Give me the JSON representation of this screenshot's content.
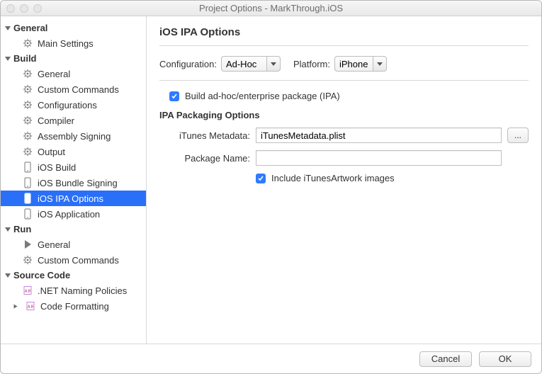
{
  "window": {
    "title": "Project Options - MarkThrough.iOS"
  },
  "sidebar": {
    "sections": [
      {
        "label": "General",
        "items": [
          {
            "label": "Main Settings",
            "icon": "gear"
          }
        ]
      },
      {
        "label": "Build",
        "items": [
          {
            "label": "General",
            "icon": "gears"
          },
          {
            "label": "Custom Commands",
            "icon": "gear"
          },
          {
            "label": "Configurations",
            "icon": "gear"
          },
          {
            "label": "Compiler",
            "icon": "gear"
          },
          {
            "label": "Assembly Signing",
            "icon": "gear"
          },
          {
            "label": "Output",
            "icon": "gear"
          },
          {
            "label": "iOS Build",
            "icon": "phone"
          },
          {
            "label": "iOS Bundle Signing",
            "icon": "phone"
          },
          {
            "label": "iOS IPA Options",
            "icon": "phone",
            "selected": true
          },
          {
            "label": "iOS Application",
            "icon": "phone"
          }
        ]
      },
      {
        "label": "Run",
        "items": [
          {
            "label": "General",
            "icon": "play"
          },
          {
            "label": "Custom Commands",
            "icon": "gear"
          }
        ]
      },
      {
        "label": "Source Code",
        "items": [
          {
            "label": ".NET Naming Policies",
            "icon": "doc"
          },
          {
            "label": "Code Formatting",
            "icon": "doc",
            "expandable": true
          }
        ]
      }
    ]
  },
  "main": {
    "heading": "iOS IPA Options",
    "config_label": "Configuration:",
    "config_value": "Ad-Hoc",
    "platform_label": "Platform:",
    "platform_value": "iPhone",
    "build_checkbox_label": "Build ad-hoc/enterprise package (IPA)",
    "build_checkbox_checked": true,
    "packaging_heading": "IPA Packaging Options",
    "itunes_label": "iTunes Metadata:",
    "itunes_value": "iTunesMetadata.plist",
    "browse_label": "...",
    "package_label": "Package Name:",
    "package_value": "",
    "include_artwork_label": "Include iTunesArtwork images",
    "include_artwork_checked": true
  },
  "footer": {
    "cancel": "Cancel",
    "ok": "OK"
  }
}
